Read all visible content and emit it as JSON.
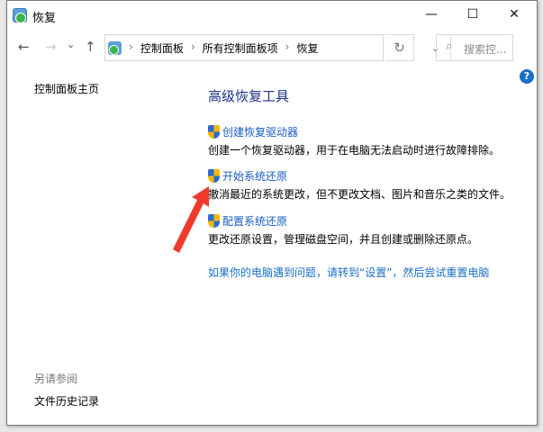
{
  "window": {
    "title": "恢复",
    "minimize": "—",
    "maximize": "☐",
    "close": "✕"
  },
  "nav": {
    "back": "←",
    "forward": "→",
    "recent": "⌄",
    "up": "↑",
    "breadcrumb": [
      "控制面板",
      "所有控制面板项",
      "恢复"
    ],
    "separator": "›",
    "dropdown": "⌄",
    "refresh": "↻",
    "search_placeholder": "搜索控...",
    "search_icon": "⌕"
  },
  "help": "?",
  "sidebar": {
    "home": "控制面板主页",
    "see_also": "另请参阅",
    "file_history": "文件历史记录"
  },
  "main": {
    "heading": "高级恢复工具",
    "items": [
      {
        "link": "创建恢复驱动器",
        "desc": "创建一个恢复驱动器，用于在电脑无法启动时进行故障排除。"
      },
      {
        "link": "开始系统还原",
        "desc": "撤消最近的系统更改，但不更改文档、图片和音乐之类的文件。"
      },
      {
        "link": "配置系统还原",
        "desc": "更改还原设置，管理磁盘空间，并且创建或删除还原点。"
      }
    ],
    "reset_link": "如果你的电脑遇到问题，请转到“设置”，然后尝试重置电脑"
  },
  "colors": {
    "heading": "#1e3287",
    "link": "#1a5bc4",
    "annotation_arrow": "#f03a2e"
  }
}
